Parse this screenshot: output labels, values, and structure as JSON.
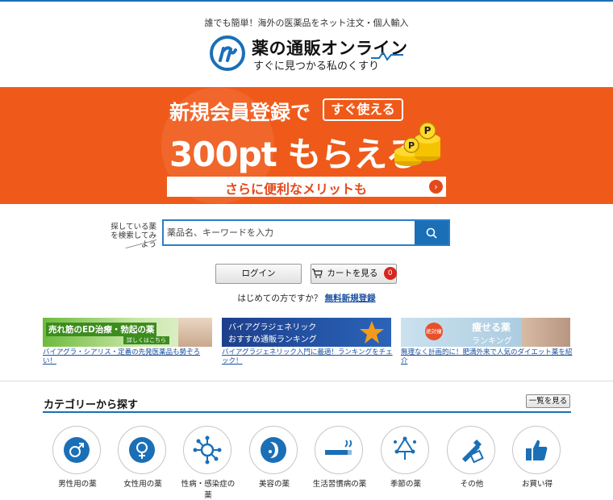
{
  "header": {
    "tagline": "誰でも簡単！海外の医薬品をネット注文・個人輸入",
    "logo_title": "薬の通販オンライン",
    "logo_subtitle": "すぐに見つかる私のくすり"
  },
  "banner": {
    "line1": "新規会員登録で",
    "badge": "すぐ使える",
    "points": "300pt もらえる",
    "strip": "さらに便利なメリットも"
  },
  "search": {
    "hint": "探している薬を検索してみよう",
    "placeholder": "薬品名、キーワードを入力"
  },
  "account": {
    "login_label": "ログイン",
    "cart_label": "カートを見る",
    "cart_count": "0",
    "first_time_text": "はじめての方ですか？",
    "register_link": "無料新規登録"
  },
  "promos": [
    {
      "headline": "売れ筋のED治療・勃起の薬",
      "button": "詳しくはこちら",
      "caption": "バイアグラ・シアリス・定番の先発医薬品も勢ぞろい！"
    },
    {
      "headline": "バイアグラジェネリック",
      "headline2": "おすすめ通販ランキング",
      "caption": "バイアグラジェネリック入門に最適！ランキングをチェック！"
    },
    {
      "badge": "絶対痩",
      "headline": "痩せる薬",
      "headline2": "ランキング",
      "caption": "無理なく計画的に！肥満外来で人気のダイエット薬を紹介"
    }
  ],
  "categories": {
    "title": "カテゴリーから探す",
    "view_all": "一覧を見る",
    "items": [
      {
        "label": "男性用の薬",
        "icon": "male-icon"
      },
      {
        "label": "女性用の薬",
        "icon": "female-icon"
      },
      {
        "label": "性病・感染症の薬",
        "icon": "virus-icon"
      },
      {
        "label": "美容の薬",
        "icon": "beauty-icon"
      },
      {
        "label": "生活習慣病の薬",
        "icon": "cigarette-icon"
      },
      {
        "label": "季節の薬",
        "icon": "season-icon"
      },
      {
        "label": "その他",
        "icon": "tools-icon"
      },
      {
        "label": "お買い得",
        "icon": "thumbs-up-icon"
      }
    ]
  },
  "colors": {
    "brand_blue": "#1a6fb7",
    "banner_orange": "#ef5a1a"
  }
}
